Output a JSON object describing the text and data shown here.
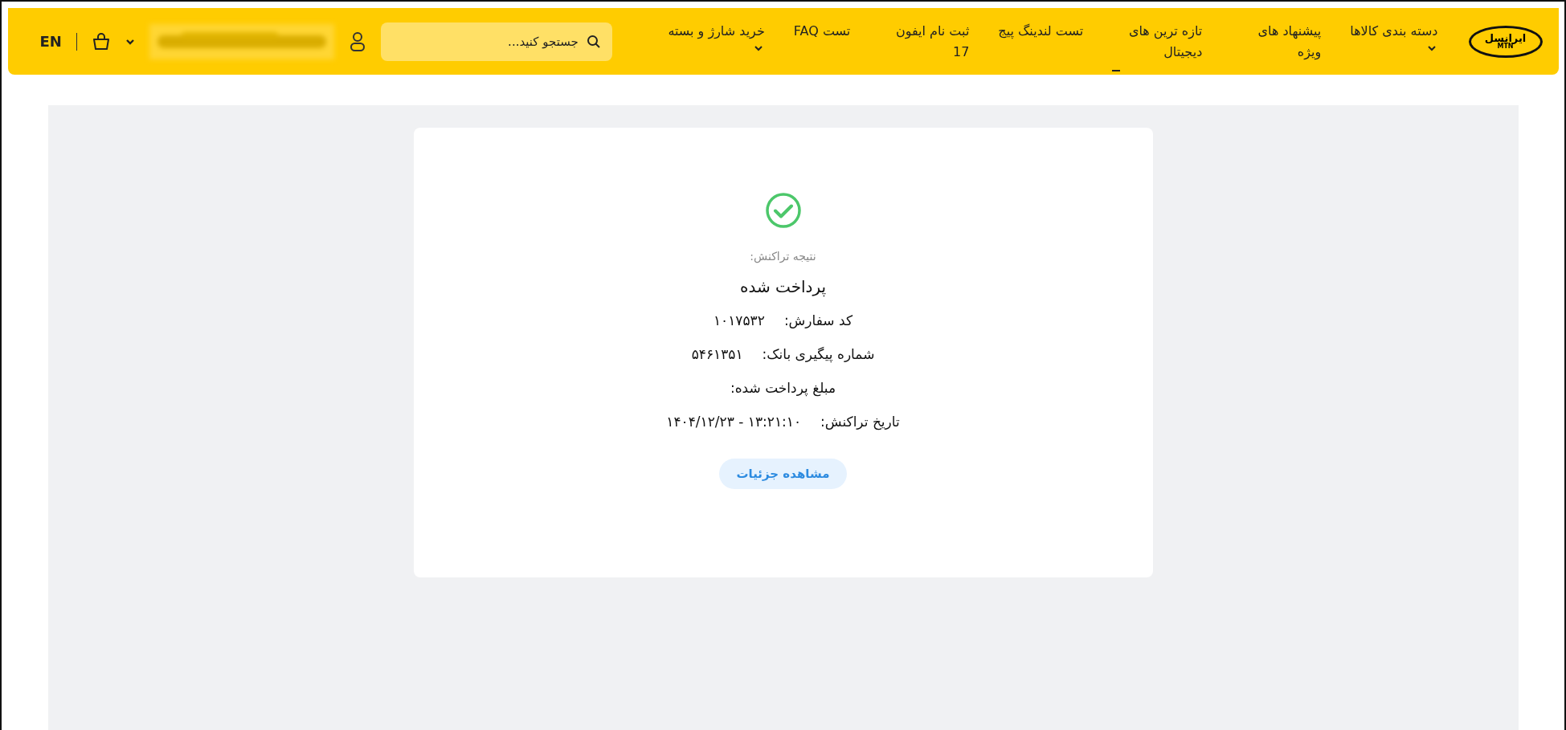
{
  "header": {
    "logo": {
      "text": "ایرانسل",
      "subtext": "MTN"
    },
    "nav": [
      {
        "label": "دسته بندی کالاها",
        "has_dropdown": true,
        "selected": false
      },
      {
        "label": "پیشنهاد های ویژه",
        "has_dropdown": false,
        "selected": false
      },
      {
        "label": "تازه ترین های دیجیتال",
        "has_dropdown": false,
        "selected": true
      },
      {
        "label": "تست لندینگ پیج",
        "has_dropdown": false,
        "selected": false
      },
      {
        "label": "ثبت نام ایفون 17",
        "has_dropdown": false,
        "selected": false
      },
      {
        "label": "تست FAQ",
        "has_dropdown": false,
        "selected": false
      },
      {
        "label": "خرید شارژ و بسته",
        "has_dropdown": true,
        "selected": false
      }
    ],
    "search": {
      "placeholder": "جستجو کنید..."
    },
    "language": "EN"
  },
  "result": {
    "caption": "نتیجه تراکنش:",
    "status": "پرداخت شده",
    "details": [
      {
        "label": "کد سفارش:",
        "value": "۱۰۱۷۵۳۲"
      },
      {
        "label": "شماره پیگیری بانک:",
        "value": "۵۴۶۱۳۵۱"
      },
      {
        "label": "مبلغ پرداخت شده:"
      },
      {
        "label": "تاریخ تراکنش:",
        "value": "۱۳:۲۱:۱۰ - ۱۴۰۴/۱۲/۲۳"
      }
    ],
    "button": "مشاهده جزئیات"
  }
}
